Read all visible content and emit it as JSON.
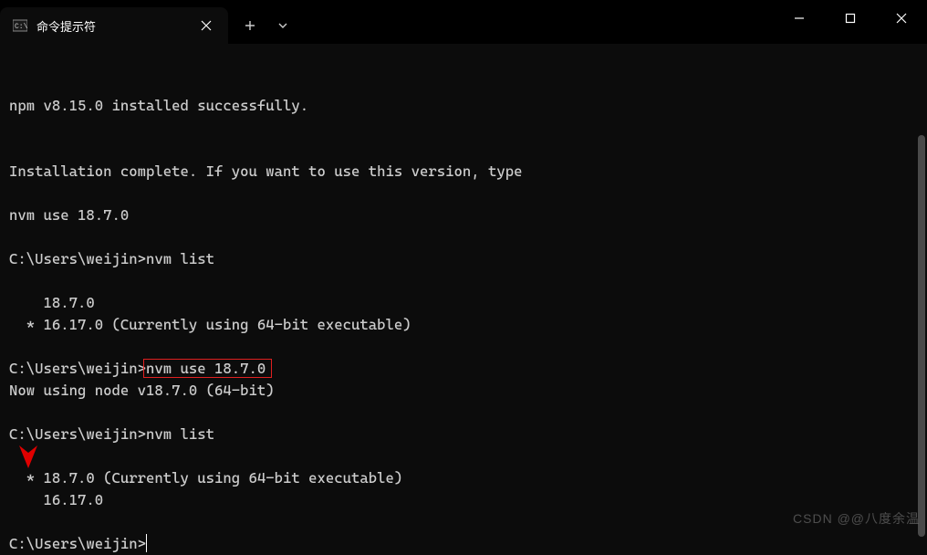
{
  "titlebar": {
    "tab_title": "命令提示符"
  },
  "terminal": {
    "lines": [
      {
        "text": "npm v8.15.0 installed successfully."
      },
      {
        "text": ""
      },
      {
        "text": ""
      },
      {
        "text": "Installation complete. If you want to use this version, type"
      },
      {
        "text": ""
      },
      {
        "text": "nvm use 18.7.0"
      },
      {
        "text": ""
      },
      {
        "prompt": "C:\\Users\\weijin>",
        "command": "nvm list"
      },
      {
        "text": ""
      },
      {
        "text": "    18.7.0"
      },
      {
        "text": "  * 16.17.0 (Currently using 64-bit executable)"
      },
      {
        "text": ""
      },
      {
        "prompt": "C:\\Users\\weijin>",
        "command": "nvm use 18.7.0",
        "highlighted": true
      },
      {
        "text": "Now using node v18.7.0 (64-bit)"
      },
      {
        "text": ""
      },
      {
        "prompt": "C:\\Users\\weijin>",
        "command": "nvm list"
      },
      {
        "text": ""
      },
      {
        "text": "  * 18.7.0 (Currently using 64-bit executable)"
      },
      {
        "text": "    16.17.0"
      },
      {
        "text": ""
      },
      {
        "prompt": "C:\\Users\\weijin>",
        "command": "",
        "cursor": true
      }
    ]
  },
  "watermark": "CSDN @@八度余温"
}
